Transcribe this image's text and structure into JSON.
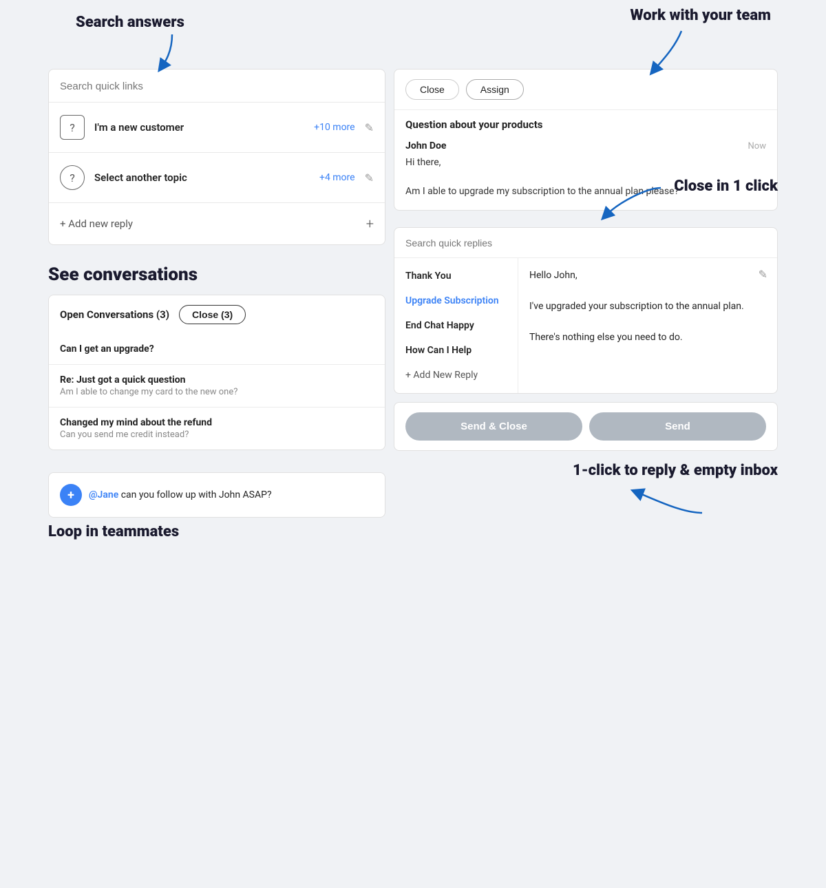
{
  "annotations": {
    "search_answers": "Search answers",
    "work_with_team": "Work with your team",
    "see_conversations": "See conversations",
    "close_in_1_click": "Close in 1 click",
    "loop_in_teammates": "Loop in teammates",
    "one_click_reply": "1-click to reply & empty inbox"
  },
  "left_panel": {
    "search_placeholder": "Search quick links",
    "items": [
      {
        "icon_type": "square",
        "icon_symbol": "?",
        "label": "I'm a new customer",
        "more": "+10 more"
      },
      {
        "icon_type": "circle",
        "icon_symbol": "?",
        "label": "Select another topic",
        "more": "+4 more"
      }
    ],
    "add_reply_label": "+ Add new reply",
    "add_reply_plus": "+"
  },
  "conversations": {
    "open_label": "Open Conversations (3)",
    "close_btn": "Close (3)",
    "items": [
      {
        "title": "Can I get an upgrade?",
        "subtitle": ""
      },
      {
        "title": "Re: Just got a quick question",
        "subtitle": "Am I able to change my card to the new one?"
      },
      {
        "title": "Changed my mind about the refund",
        "subtitle": "Can you send me credit instead?"
      }
    ]
  },
  "teammate": {
    "mention": "@Jane",
    "text": " can you follow up with John ASAP?"
  },
  "right_panel": {
    "close_btn": "Close",
    "assign_btn": "Assign",
    "subject": "Question about your products",
    "sender": "John Doe",
    "time": "Now",
    "message": "Hi there,\n\nAm I able to upgrade my subscription to the annual plan please?"
  },
  "quick_replies": {
    "search_placeholder": "Search quick replies",
    "items": [
      {
        "label": "Thank You",
        "active": false
      },
      {
        "label": "Upgrade Subscription",
        "active": true
      },
      {
        "label": "End Chat Happy",
        "active": false
      },
      {
        "label": "How Can I Help",
        "active": false
      },
      {
        "label": "+ Add New Reply",
        "add": true
      }
    ],
    "preview_greeting": "Hello John,",
    "preview_body": "I've upgraded your subscription to the annual plan.\n\nThere's nothing else you need to do."
  },
  "actions": {
    "send_close_btn": "Send & Close",
    "send_btn": "Send"
  }
}
